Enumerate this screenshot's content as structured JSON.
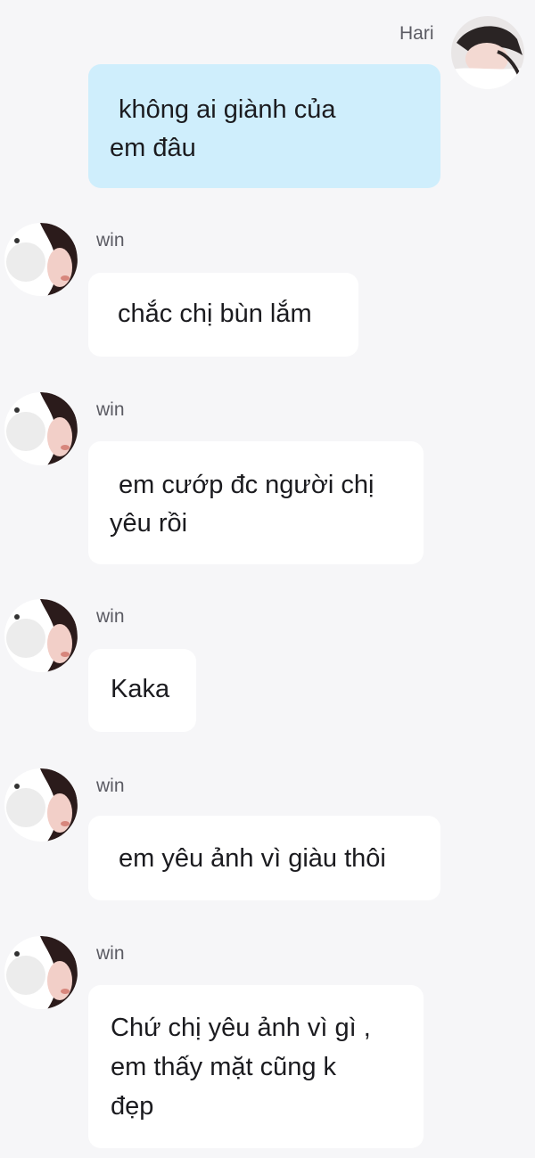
{
  "self": {
    "name": "Hari"
  },
  "messages": [
    {
      "sender": "Hari",
      "lines": [
        "không ai giành của",
        "em đâu"
      ]
    },
    {
      "sender": "win",
      "lines": [
        "chắc chị bùn lắm"
      ]
    },
    {
      "sender": "win",
      "lines": [
        "em cướp đc người chị",
        "yêu rồi"
      ]
    },
    {
      "sender": "win",
      "lines": [
        "Kaka"
      ]
    },
    {
      "sender": "win",
      "lines": [
        "em yêu ảnh vì giàu thôi"
      ]
    },
    {
      "sender": "win",
      "lines": [
        "Chứ chị yêu ảnh vì gì ,",
        "em thấy mặt cũng k",
        "đẹp"
      ]
    }
  ],
  "colors": {
    "background": "#f6f6f8",
    "own_bubble": "#cfeefc",
    "other_bubble": "#ffffff"
  }
}
